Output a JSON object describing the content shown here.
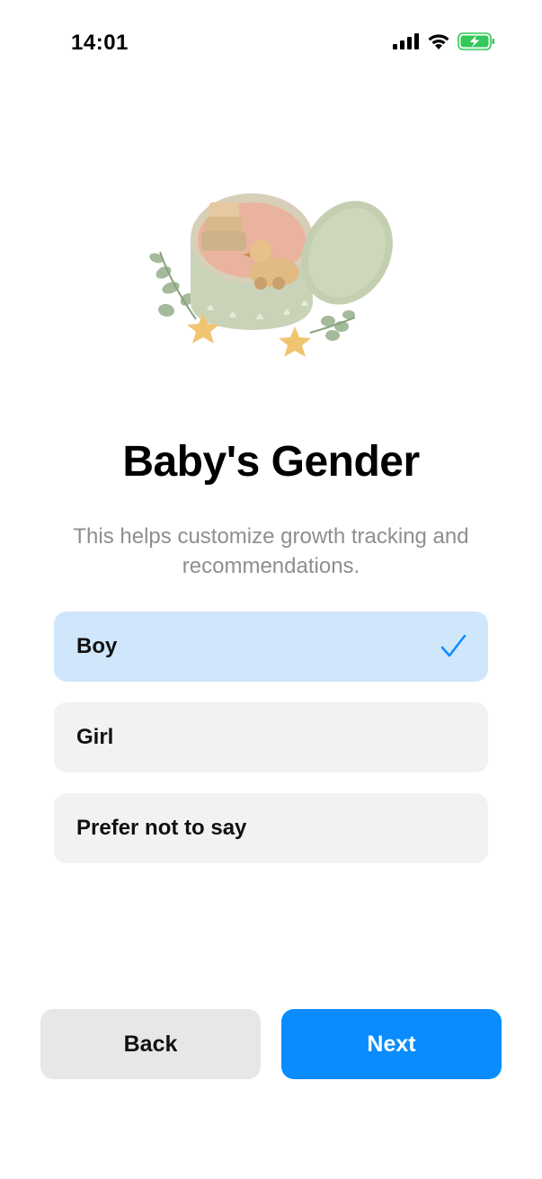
{
  "status_bar": {
    "time": "14:01",
    "icons": [
      "signal-icon",
      "wifi-icon",
      "battery-charging-icon"
    ],
    "battery_color": "#34c759"
  },
  "illustration": {
    "name": "gift-box-with-baby-toys-illustration"
  },
  "header": {
    "title": "Baby's Gender",
    "subtitle": "This helps customize growth tracking and recommendations."
  },
  "options": [
    {
      "label": "Boy",
      "selected": true
    },
    {
      "label": "Girl",
      "selected": false
    },
    {
      "label": "Prefer not to say",
      "selected": false
    }
  ],
  "footer": {
    "back_label": "Back",
    "next_label": "Next"
  },
  "colors": {
    "accent": "#0a8cff",
    "selected_bg": "#cfe6fb",
    "option_bg": "#f2f2f3",
    "secondary_text": "#8e8e93"
  }
}
